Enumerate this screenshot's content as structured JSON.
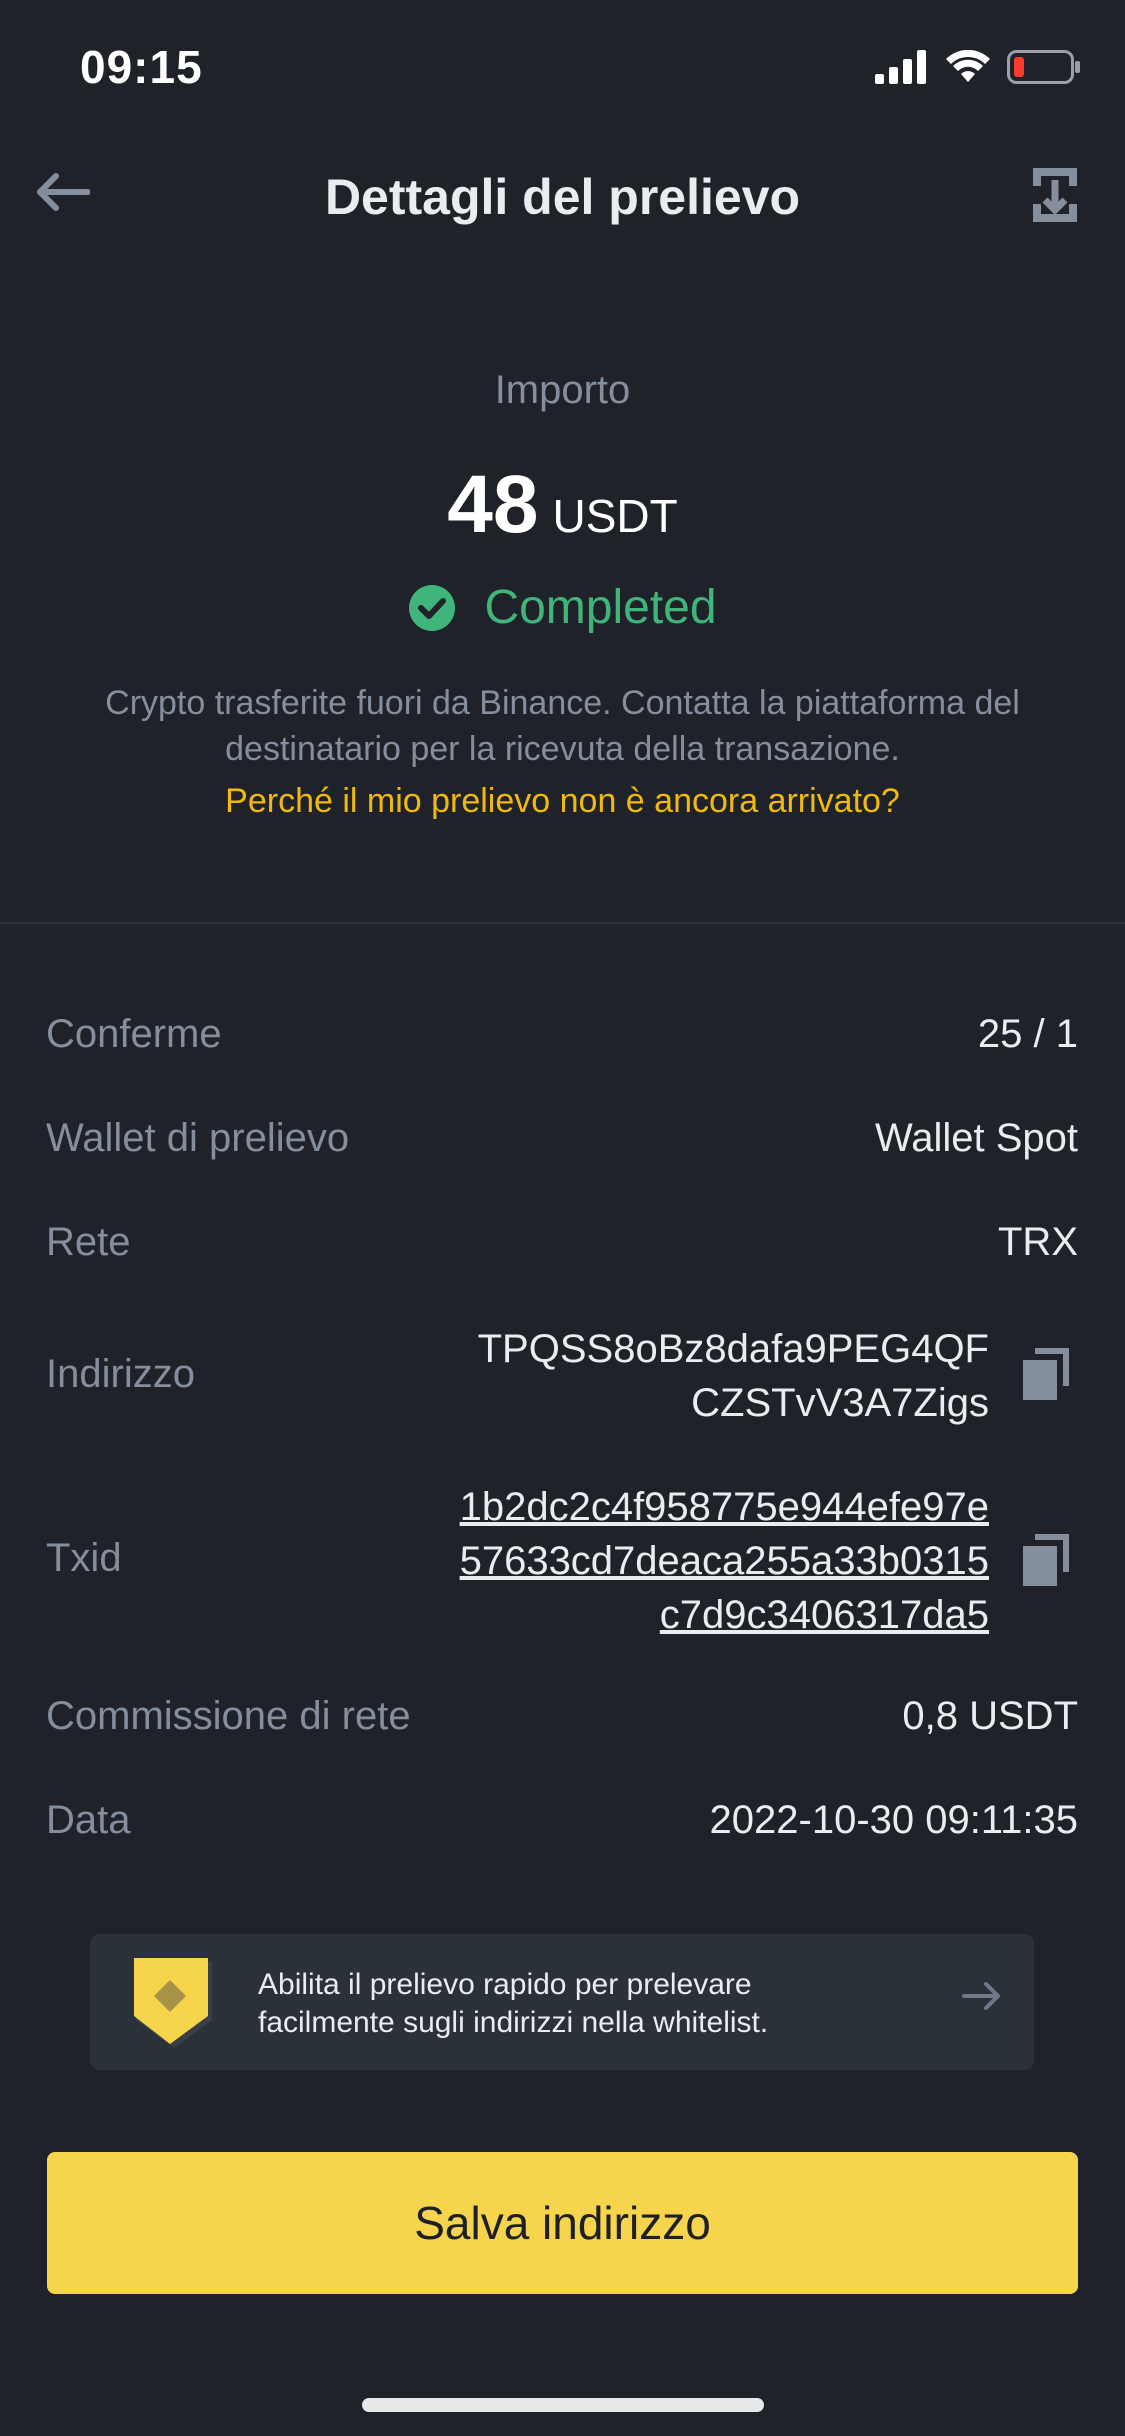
{
  "status_bar": {
    "time": "09:15"
  },
  "header": {
    "title": "Dettagli del prelievo"
  },
  "amount": {
    "label": "Importo",
    "value": "48",
    "unit": "USDT"
  },
  "status": {
    "text": "Completed",
    "color": "#3fb57c"
  },
  "description": "Crypto trasferite fuori da Binance. Contatta la piattaforma del destinatario per la ricevuta della transazione.",
  "help_link": "Perché il mio prelievo non è ancora arrivato?",
  "details": {
    "confirmations": {
      "label": "Conferme",
      "value": "25 / 1"
    },
    "wallet": {
      "label": "Wallet di prelievo",
      "value": "Wallet Spot"
    },
    "network": {
      "label": "Rete",
      "value": "TRX"
    },
    "address": {
      "label": "Indirizzo",
      "value": "TPQSS8oBz8dafa9PEG4QFCZSTvV3A7Zigs"
    },
    "txid": {
      "label": "Txid",
      "value": "1b2dc2c4f958775e944efe97e57633cd7deaca255a33b0315c7d9c3406317da5"
    },
    "fee": {
      "label": "Commissione di rete",
      "value": "0,8 USDT"
    },
    "date": {
      "label": "Data",
      "value": "2022-10-30 09:11:35"
    }
  },
  "banner": {
    "text": "Abilita il prelievo rapido per prelevare facilmente sugli indirizzi nella whitelist."
  },
  "primary_button": {
    "label": "Salva indirizzo"
  },
  "colors": {
    "background": "#1f2329",
    "accent_yellow": "#f0b90b",
    "button_yellow": "#f6d44c",
    "success_green": "#3fb57c",
    "muted_text": "#848e9c"
  }
}
